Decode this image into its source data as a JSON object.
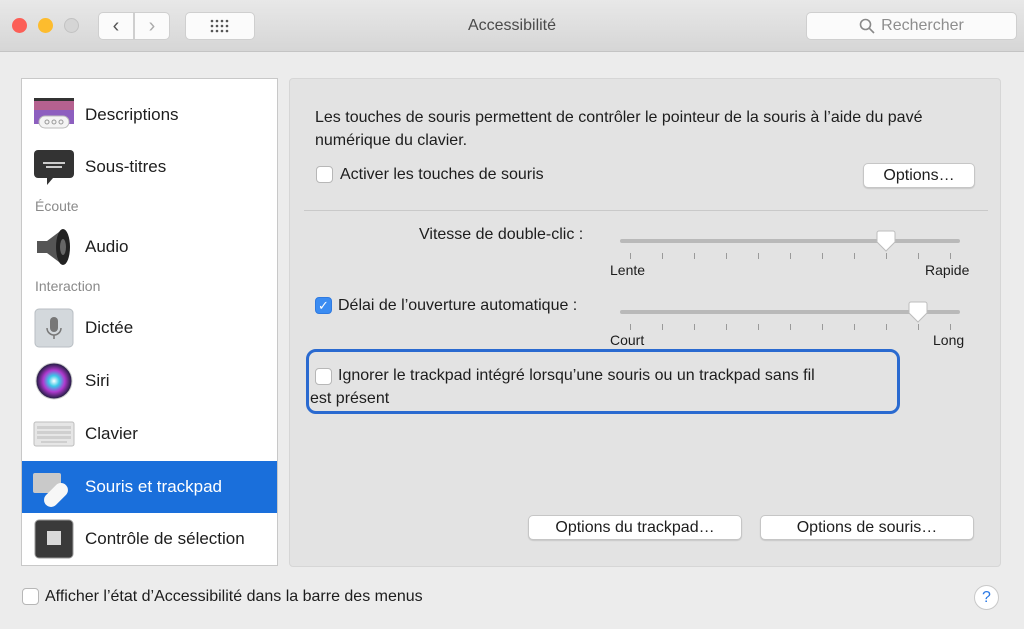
{
  "window": {
    "title": "Accessibilité",
    "search_placeholder": "Rechercher",
    "back_icon": "‹",
    "forward_icon": "›"
  },
  "sidebar": {
    "items": [
      {
        "label": "Descriptions",
        "icon": "descriptions-icon",
        "selected": false
      },
      {
        "label": "Sous-titres",
        "icon": "subtitles-icon",
        "selected": false
      },
      {
        "section": "Écoute"
      },
      {
        "label": "Audio",
        "icon": "speaker-icon",
        "selected": false
      },
      {
        "section": "Interaction"
      },
      {
        "label": "Dictée",
        "icon": "microphone-icon",
        "selected": false
      },
      {
        "label": "Siri",
        "icon": "siri-icon",
        "selected": false
      },
      {
        "label": "Clavier",
        "icon": "keyboard-icon",
        "selected": false
      },
      {
        "label": "Souris et trackpad",
        "icon": "mouse-trackpad-icon",
        "selected": true
      },
      {
        "label": "Contrôle de sélection",
        "icon": "switch-control-icon",
        "selected": false
      }
    ]
  },
  "main": {
    "description": "Les touches de souris permettent de contrôler le pointeur de la souris à l’aide du pavé numérique du clavier.",
    "mouse_keys": {
      "label": "Activer les touches de souris",
      "checked": false
    },
    "options_button": "Options…",
    "double_click": {
      "label": "Vitesse de double-clic :",
      "min_label": "Lente",
      "max_label": "Rapide",
      "ticks": 11,
      "value": 0.8
    },
    "spring_loading": {
      "label": "Délai de l’ouverture automatique :",
      "checked": true,
      "min_label": "Court",
      "max_label": "Long",
      "ticks": 11,
      "value": 0.9
    },
    "ignore_trackpad": {
      "label_line1": "Ignorer le trackpad intégré lorsqu’une souris ou un trackpad sans fil",
      "label_line2": "est présent",
      "checked": false
    },
    "trackpad_options_button": "Options du trackpad…",
    "mouse_options_button": "Options de souris…"
  },
  "footer": {
    "show_status": {
      "label": "Afficher l’état d’Accessibilité dans la barre des menus",
      "checked": false
    },
    "help": "?"
  },
  "colors": {
    "accent": "#1a6fdb",
    "focus_ring": "#2a6ad0"
  }
}
